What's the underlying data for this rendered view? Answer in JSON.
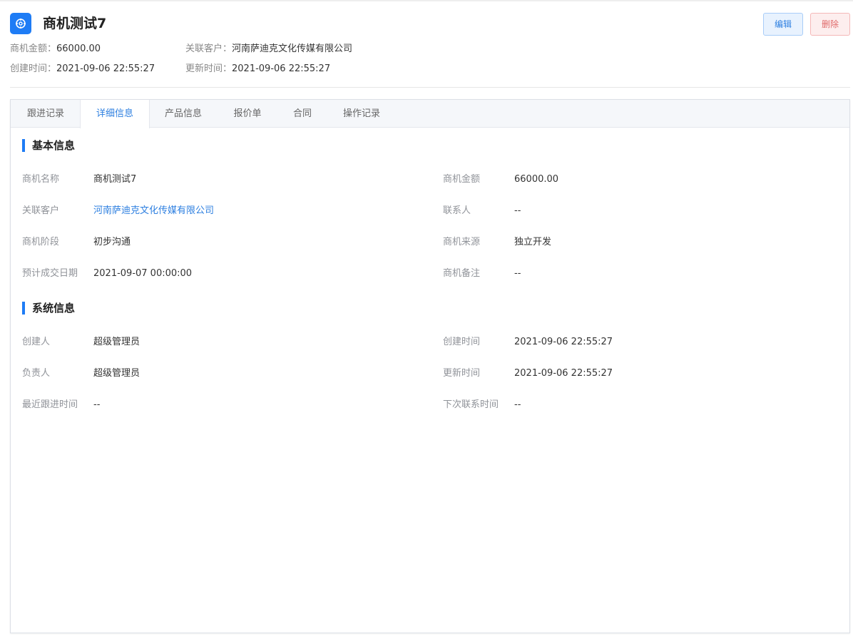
{
  "header": {
    "title": "商机测试7",
    "amount_label": "商机金额：",
    "amount_value": "66000.00",
    "customer_label": "关联客户：",
    "customer_value": "河南萨迪克文化传媒有限公司",
    "created_label": "创建时间：",
    "created_value": "2021-09-06 22:55:27",
    "updated_label": "更新时间：",
    "updated_value": "2021-09-06 22:55:27",
    "edit_button": "编辑",
    "delete_button": "删除"
  },
  "tabs": [
    {
      "label": "跟进记录",
      "active": false
    },
    {
      "label": "详细信息",
      "active": true
    },
    {
      "label": "产品信息",
      "active": false
    },
    {
      "label": "报价单",
      "active": false
    },
    {
      "label": "合同",
      "active": false
    },
    {
      "label": "操作记录",
      "active": false
    }
  ],
  "basic": {
    "title": "基本信息",
    "name_label": "商机名称",
    "name_value": "商机测试7",
    "amount_label": "商机金额",
    "amount_value": "66000.00",
    "customer_label": "关联客户",
    "customer_value": "河南萨迪克文化传媒有限公司",
    "contact_label": "联系人",
    "contact_value": "--",
    "stage_label": "商机阶段",
    "stage_value": "初步沟通",
    "source_label": "商机来源",
    "source_value": "独立开发",
    "deal_date_label": "预计成交日期",
    "deal_date_value": "2021-09-07 00:00:00",
    "remark_label": "商机备注",
    "remark_value": "--"
  },
  "system": {
    "title": "系统信息",
    "creator_label": "创建人",
    "creator_value": "超级管理员",
    "created_label": "创建时间",
    "created_value": "2021-09-06 22:55:27",
    "owner_label": "负责人",
    "owner_value": "超级管理员",
    "updated_label": "更新时间",
    "updated_value": "2021-09-06 22:55:27",
    "last_follow_label": "最近跟进时间",
    "last_follow_value": "--",
    "next_contact_label": "下次联系时间",
    "next_contact_value": "--"
  },
  "colors": {
    "accent": "#1e7cf5",
    "link": "#2d7fe0",
    "danger": "#e06a6a"
  }
}
